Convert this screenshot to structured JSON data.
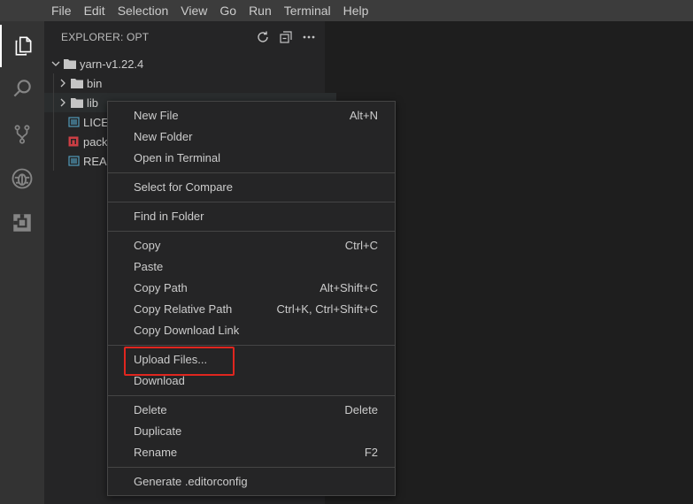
{
  "menubar": {
    "items": [
      "File",
      "Edit",
      "Selection",
      "View",
      "Go",
      "Run",
      "Terminal",
      "Help"
    ]
  },
  "activity_bar": {
    "icons": [
      "files-icon",
      "search-icon",
      "source-control-icon",
      "debug-icon",
      "extensions-icon"
    ]
  },
  "sidebar": {
    "title": "EXPLORER: OPT",
    "tree": [
      {
        "label": "yarn-v1.22.4",
        "icon": "folder-icon",
        "expanded": true
      },
      {
        "label": "bin",
        "icon": "folder-icon",
        "expanded": false
      },
      {
        "label": "lib",
        "icon": "folder-icon",
        "expanded": false
      },
      {
        "label": "LICE",
        "icon": "license-file-icon"
      },
      {
        "label": "packa",
        "icon": "json-file-icon"
      },
      {
        "label": "READ",
        "icon": "readme-file-icon"
      }
    ]
  },
  "context_menu": {
    "items": [
      {
        "label": "New File",
        "shortcut": "Alt+N"
      },
      {
        "label": "New Folder",
        "shortcut": ""
      },
      {
        "label": "Open in Terminal",
        "shortcut": ""
      },
      {
        "label": "Select for Compare",
        "shortcut": ""
      },
      {
        "label": "Find in Folder",
        "shortcut": ""
      },
      {
        "label": "Copy",
        "shortcut": "Ctrl+C"
      },
      {
        "label": "Paste",
        "shortcut": ""
      },
      {
        "label": "Copy Path",
        "shortcut": "Alt+Shift+C"
      },
      {
        "label": "Copy Relative Path",
        "shortcut": "Ctrl+K, Ctrl+Shift+C"
      },
      {
        "label": "Copy Download Link",
        "shortcut": ""
      },
      {
        "label": "Upload Files...",
        "shortcut": ""
      },
      {
        "label": "Download",
        "shortcut": ""
      },
      {
        "label": "Delete",
        "shortcut": "Delete"
      },
      {
        "label": "Duplicate",
        "shortcut": ""
      },
      {
        "label": "Rename",
        "shortcut": "F2"
      },
      {
        "label": "Generate .editorconfig",
        "shortcut": ""
      }
    ]
  },
  "colors": {
    "highlight": "#e0261f",
    "activity_bar": "#333333",
    "sidebar": "#252526",
    "editor": "#1e1e1e"
  }
}
